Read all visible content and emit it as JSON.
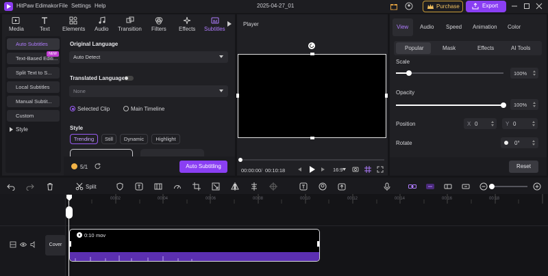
{
  "app": {
    "title": "HitPaw Edimakor",
    "date_title": "2025-04-27_01"
  },
  "menu": [
    "File",
    "Settings",
    "Help"
  ],
  "actions": {
    "purchase": "Purchase",
    "export": "Export"
  },
  "media_tabs": [
    "Media",
    "Text",
    "Elements",
    "Audio",
    "Transition",
    "Filters",
    "Effects",
    "Subtitles"
  ],
  "sidebar": {
    "items": [
      "Auto Subtitles",
      "Text-Based Editi...",
      "Split Text to S...",
      "Local Subtitles",
      "Manual Subtit...",
      "Custom",
      "Style"
    ],
    "new_badge": "NEW"
  },
  "subtitle_panel": {
    "original_language_label": "Original Language",
    "original_language_value": "Auto Detect",
    "translated_language_label": "Translated Language",
    "translated_language_value": "None",
    "scope_options": [
      "Selected Clip",
      "Main Timeline"
    ],
    "style_label": "Style",
    "style_chips": [
      "Trending",
      "Still",
      "Dynamic",
      "Highlight"
    ],
    "credits": "5/1",
    "auto_subtitling_button": "Auto Subtitling"
  },
  "player": {
    "title": "Player",
    "current_time": "00:00:00",
    "total_time": "00:10:18",
    "aspect_ratio": "16:9"
  },
  "properties": {
    "tabs": [
      "View",
      "Audio",
      "Speed",
      "Animation",
      "Color"
    ],
    "subtabs": [
      "Popular",
      "Mask",
      "Effects",
      "AI Tools"
    ],
    "scale_label": "Scale",
    "scale_value": "100%",
    "scale_fraction": 0.12,
    "opacity_label": "Opacity",
    "opacity_value": "100%",
    "opacity_fraction": 1.0,
    "position_label": "Position",
    "position_x_label": "X",
    "position_x_value": "0",
    "position_y_label": "Y",
    "position_y_value": "0",
    "rotate_label": "Rotate",
    "rotate_value": "0°",
    "reset_button": "Reset"
  },
  "timeline": {
    "split_label": "Split",
    "ruler_labels": [
      "00:02",
      "00:04",
      "00:06",
      "00:08",
      "00:10",
      "00:12",
      "00:14",
      "00:16",
      "00:18"
    ],
    "cover_label": "Cover",
    "clip_duration": "0:10",
    "clip_name": "mov"
  },
  "colors": {
    "accent": "#8a3ff3",
    "purchase": "#c79a35",
    "clip_wave": "#5b2fb0",
    "background": "#151518"
  }
}
